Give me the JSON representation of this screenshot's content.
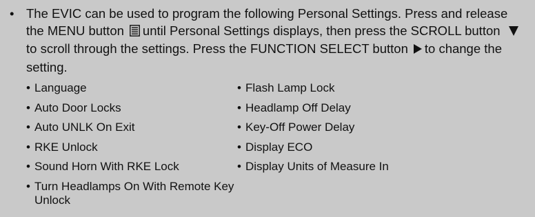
{
  "intro": {
    "part1": "The EVIC can be used to program the following Personal Settings. Press and release the MENU button",
    "part2": "until Personal Settings displays, then press the SCROLL button",
    "part3": "to scroll through the settings. Press the FUNCTION SELECT button",
    "part4": "to change the setting."
  },
  "icons": {
    "menu": "menu-button-icon",
    "scroll": "down-triangle-icon",
    "select": "right-triangle-icon"
  },
  "settings": {
    "left": [
      "Language",
      "Auto Door Locks",
      "Auto UNLK On Exit",
      "RKE Unlock",
      "Sound Horn With RKE Lock",
      "Turn Headlamps On With Remote Key Unlock"
    ],
    "right": [
      "Flash Lamp Lock",
      "Headlamp Off Delay",
      "Key-Off Power Delay",
      "Display ECO",
      "Display Units of Measure In"
    ]
  },
  "colors": {
    "background": "#c9c9c9",
    "text": "#111111"
  }
}
